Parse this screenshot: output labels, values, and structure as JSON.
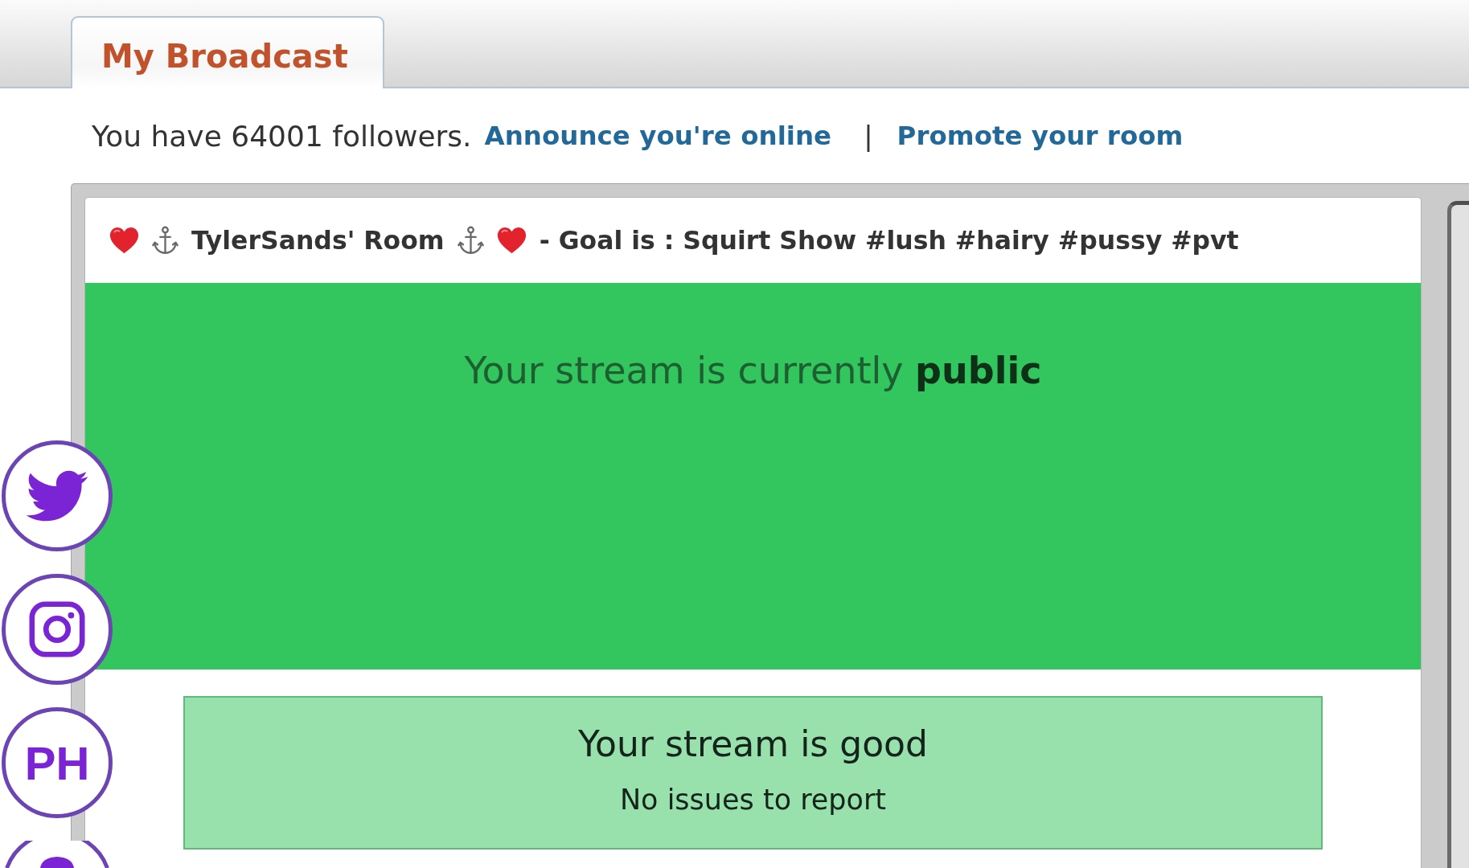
{
  "tabs": [
    {
      "label": "My Broadcast",
      "selected": true
    }
  ],
  "followers": {
    "text": "You have 64001 followers.",
    "links": [
      "Announce you're online",
      "Promote your room"
    ],
    "separator": "|"
  },
  "room_title": [
    {
      "kind": "heart"
    },
    {
      "kind": "anchor"
    },
    {
      "kind": "text",
      "text": "TylerSands' Room"
    },
    {
      "kind": "anchor"
    },
    {
      "kind": "heart"
    },
    {
      "kind": "text",
      "text": "- Goal is : Squirt Show #lush #hairy #pussy #pvt"
    }
  ],
  "stream_preview": {
    "status": "Your stream is currently **public**"
  },
  "stream_health": {
    "title": "Your stream is good",
    "detail": "No issues to report"
  },
  "social_links": [
    {
      "kind": "bird"
    },
    {
      "kind": "camera"
    },
    {
      "kind": "text",
      "label": "PH"
    },
    {
      "kind": "cut-off"
    }
  ]
}
